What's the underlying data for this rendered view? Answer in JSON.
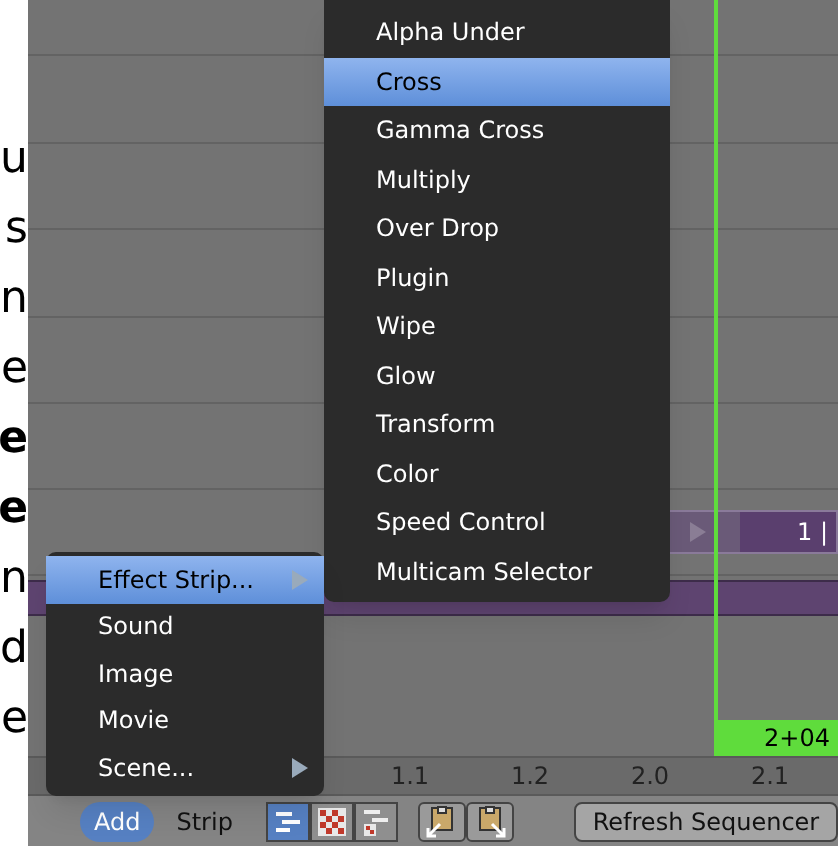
{
  "margin_letters": [
    {
      "text": "u",
      "bold": false
    },
    {
      "text": "s",
      "bold": false
    },
    {
      "text": "n",
      "bold": false
    },
    {
      "text": "e",
      "bold": false
    },
    {
      "text": "e",
      "bold": true
    },
    {
      "text": "e",
      "bold": true
    },
    {
      "text": "n",
      "bold": false
    },
    {
      "text": "d",
      "bold": false
    },
    {
      "text": "e",
      "bold": false
    }
  ],
  "effect_menu": {
    "items": [
      {
        "label": "Alpha Under",
        "selected": false
      },
      {
        "label": "Cross",
        "selected": true
      },
      {
        "label": "Gamma Cross",
        "selected": false
      },
      {
        "label": "Multiply",
        "selected": false
      },
      {
        "label": "Over Drop",
        "selected": false
      },
      {
        "label": "Plugin",
        "selected": false
      },
      {
        "label": "Wipe",
        "selected": false
      },
      {
        "label": "Glow",
        "selected": false
      },
      {
        "label": "Transform",
        "selected": false
      },
      {
        "label": "Color",
        "selected": false
      },
      {
        "label": "Speed Control",
        "selected": false
      },
      {
        "label": "Multicam Selector",
        "selected": false
      }
    ]
  },
  "add_menu": {
    "items": [
      {
        "label": "Effect Strip...",
        "selected": true,
        "submenu": true
      },
      {
        "label": "Sound",
        "selected": false,
        "submenu": false
      },
      {
        "label": "Image",
        "selected": false,
        "submenu": false
      },
      {
        "label": "Movie",
        "selected": false,
        "submenu": false
      },
      {
        "label": "Scene...",
        "selected": false,
        "submenu": true
      }
    ]
  },
  "strip": {
    "label": "1 |"
  },
  "playhead": {
    "frame": "2+04"
  },
  "ruler": {
    "labels": [
      "1.1",
      "1.2",
      "2.0",
      "2.1"
    ]
  },
  "header": {
    "menus": [
      {
        "label": "Add",
        "selected": true
      },
      {
        "label": "Strip",
        "selected": false
      }
    ],
    "view_buttons": [
      {
        "kind": "sequencer",
        "selected": true
      },
      {
        "kind": "preview",
        "selected": false
      },
      {
        "kind": "both",
        "selected": false
      }
    ],
    "refresh_button": "Refresh Sequencer"
  }
}
